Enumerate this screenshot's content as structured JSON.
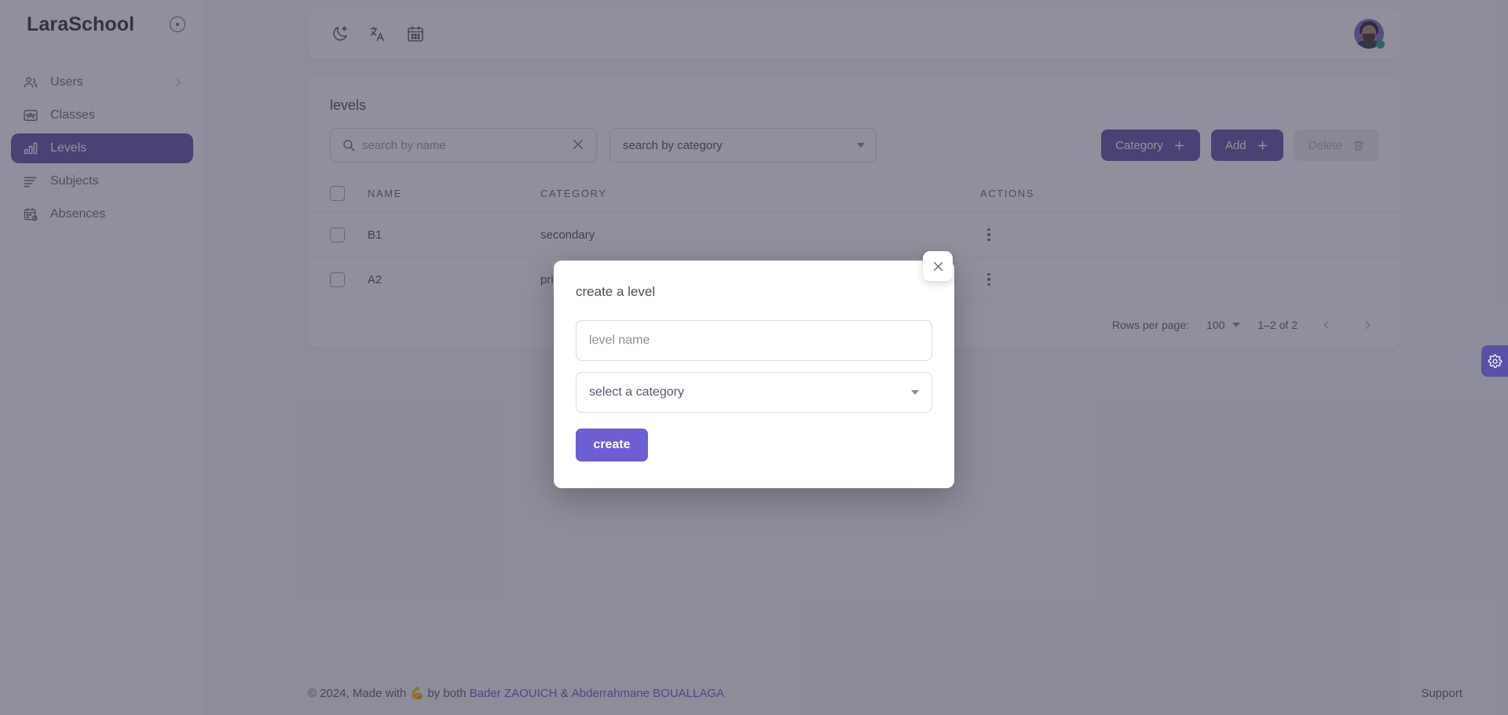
{
  "brand": {
    "title": "LaraSchool",
    "toggle_icon": "circle-dot-icon"
  },
  "sidebar": {
    "items": [
      {
        "label": "Users",
        "icon": "users-icon",
        "active": false,
        "has_chevron": true
      },
      {
        "label": "Classes",
        "icon": "classroom-icon",
        "active": false,
        "has_chevron": false
      },
      {
        "label": "Levels",
        "icon": "bar-chart-icon",
        "active": true,
        "has_chevron": false
      },
      {
        "label": "Subjects",
        "icon": "list-icon",
        "active": false,
        "has_chevron": false
      },
      {
        "label": "Absences",
        "icon": "calendar-clock-icon",
        "active": false,
        "has_chevron": false
      }
    ]
  },
  "topbar": {
    "icons": [
      {
        "name": "dark-mode-icon"
      },
      {
        "name": "translate-icon"
      },
      {
        "name": "calendar-icon"
      }
    ],
    "avatar": {
      "name": "user-avatar",
      "status": "online",
      "status_color": "#1aa179"
    }
  },
  "page": {
    "title": "levels"
  },
  "toolbar": {
    "search_name": {
      "value": "",
      "placeholder": "search by name",
      "icon": "search-icon",
      "clear_icon": "close-icon"
    },
    "search_category": {
      "value": "search by category",
      "placeholder": "search by category",
      "icon": "chevron-down-icon"
    },
    "buttons": [
      {
        "label": "Category",
        "icon": "plus-icon",
        "style": "primary",
        "disabled": false
      },
      {
        "label": "Add",
        "icon": "plus-icon",
        "style": "primary",
        "disabled": false
      },
      {
        "label": "Delete",
        "icon": "trash-icon",
        "style": "disabled",
        "disabled": true
      }
    ]
  },
  "table": {
    "columns": [
      "NAME",
      "CATEGORY",
      "ACTIONS"
    ],
    "rows": [
      {
        "name": "B1",
        "category": "secondary",
        "checked": false
      },
      {
        "name": "A2",
        "category": "primary",
        "checked": false
      }
    ]
  },
  "pagination": {
    "rows_per_page_label": "Rows per page:",
    "rows_per_page_value": "100",
    "range_label": "1–2 of 2",
    "prev_icon": "chevron-left-icon",
    "next_icon": "chevron-right-icon"
  },
  "modal": {
    "title": "create a level",
    "name_field": {
      "value": "",
      "placeholder": "level name"
    },
    "category_select": {
      "value": "select a category",
      "icon": "chevron-down-icon"
    },
    "create_label": "create",
    "close_icon": "close-icon"
  },
  "settings_tab": {
    "icon": "gear-icon"
  },
  "footer": {
    "copyright_prefix": "© 2024, Made with",
    "emoji": "💪",
    "middle": "by both",
    "author_one": "Bader ZAOUICH",
    "ampersand": "&",
    "author_two": "Abderrahmane BOUALLAGA",
    "support": "Support"
  },
  "colors": {
    "accent": "#5b50a8",
    "accent_bright": "#6c5fd4",
    "text": "#4e4c5e",
    "muted": "#6d6b7c",
    "overlay": "#3a374d",
    "online": "#1aa179"
  }
}
